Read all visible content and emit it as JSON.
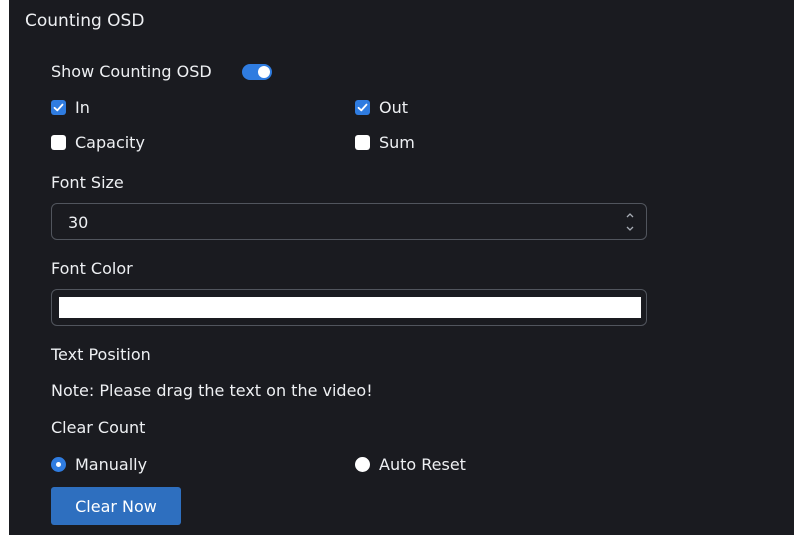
{
  "section_title": "Counting OSD",
  "show_osd": {
    "label": "Show Counting OSD",
    "enabled": true
  },
  "checkboxes": [
    {
      "label": "In",
      "checked": true
    },
    {
      "label": "Out",
      "checked": true
    },
    {
      "label": "Capacity",
      "checked": false
    },
    {
      "label": "Sum",
      "checked": false
    }
  ],
  "font_size": {
    "label": "Font Size",
    "value": "30"
  },
  "font_color": {
    "label": "Font Color",
    "value": "#ffffff"
  },
  "text_position": {
    "label": "Text Position",
    "note": "Note: Please drag the text on the video!"
  },
  "clear_count": {
    "label": "Clear Count",
    "options": [
      {
        "label": "Manually",
        "selected": true
      },
      {
        "label": "Auto Reset",
        "selected": false
      }
    ],
    "button_label": "Clear Now"
  },
  "colors": {
    "accent": "#2f7ce0",
    "panel": "#1a1b20",
    "button": "#2e6fbf"
  }
}
